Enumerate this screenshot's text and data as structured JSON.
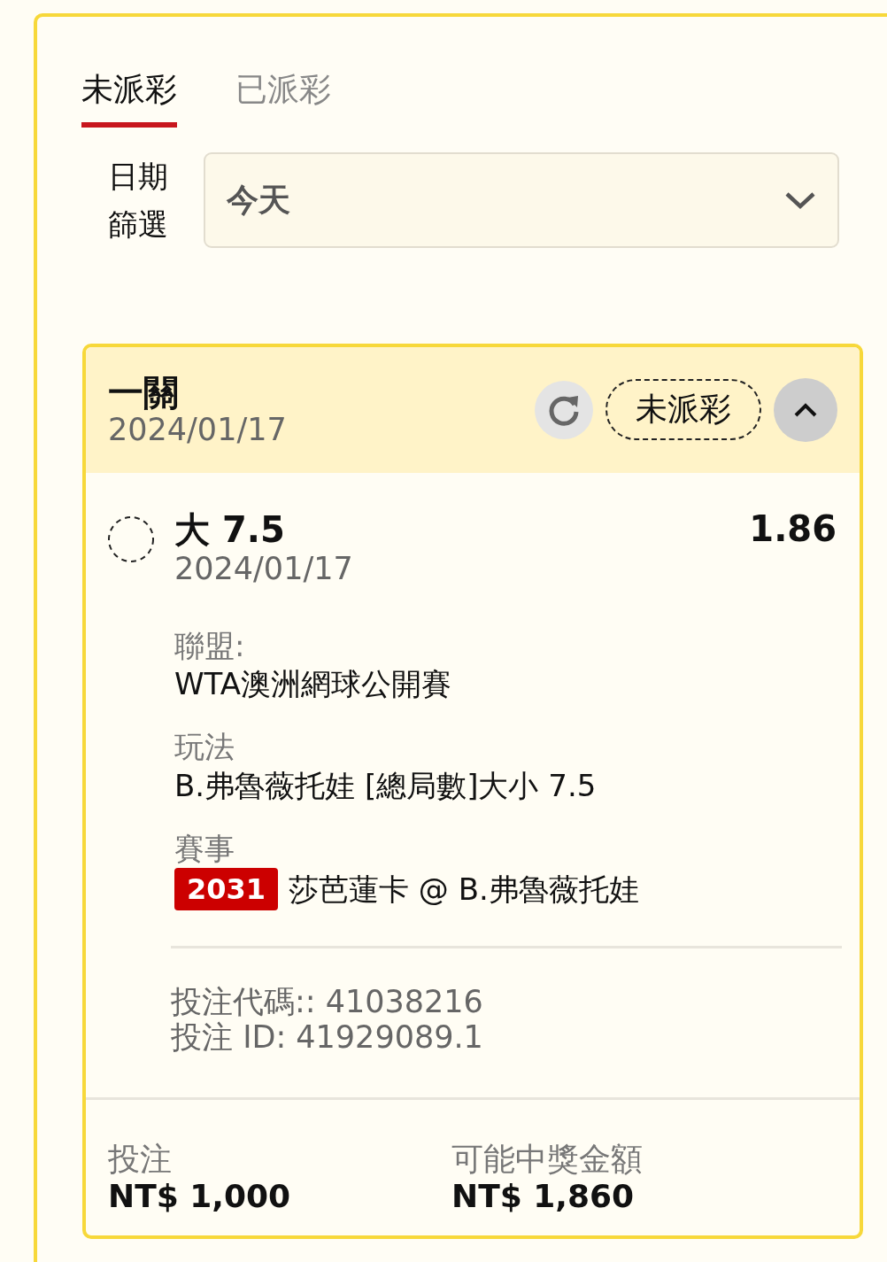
{
  "tabs": [
    {
      "label": "未派彩",
      "selected": true
    },
    {
      "label": "已派彩",
      "selected": false
    }
  ],
  "date_filter": {
    "label": "日期篩選",
    "value": "今天"
  },
  "bet_card": {
    "type": "一關",
    "date": "2024/01/17",
    "status": "未派彩",
    "expanded": true,
    "selection": {
      "selected": false,
      "name": "大 7.5",
      "date": "2024/01/17",
      "odds": "1.86"
    },
    "details": [
      {
        "label": "聯盟:",
        "value": "WTA澳洲網球公開賽"
      },
      {
        "label": "玩法",
        "value": "B.弗魯薇托娃 [總局數]大小 7.5"
      }
    ],
    "event": {
      "label": "賽事",
      "code": "2031",
      "match": "莎芭蓮卡 @ B.弗魯薇托娃"
    },
    "bet_code": "投注代碼:: 41038216",
    "bet_id": "投注 ID: 41929089.1",
    "stake": {
      "label": "投注",
      "value": "NT$ 1,000"
    },
    "payout": {
      "label": "可能中獎金額",
      "value": "NT$ 1,860"
    }
  }
}
